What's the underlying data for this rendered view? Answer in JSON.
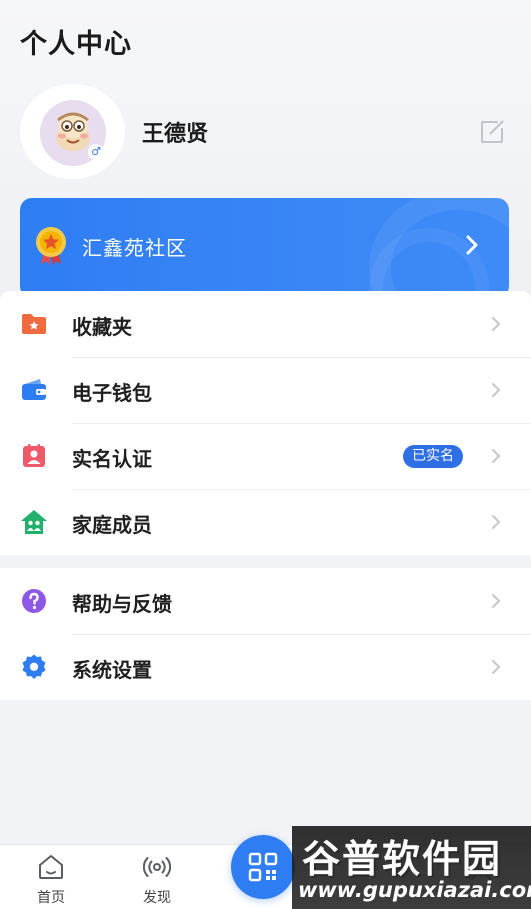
{
  "header": {
    "title": "个人中心"
  },
  "profile": {
    "name": "王德贤",
    "gender_symbol": "♂",
    "avatar_icon": "cartoon-avatar-icon",
    "edit_icon": "edit-icon"
  },
  "community": {
    "label": "汇鑫苑社区",
    "icon": "medal-icon"
  },
  "menu_group_1": [
    {
      "label": "收藏夹",
      "icon": "folder-star-icon",
      "color": "#ef6a3f"
    },
    {
      "label": "电子钱包",
      "icon": "wallet-icon",
      "color": "#2f7df3"
    },
    {
      "label": "实名认证",
      "icon": "id-card-icon",
      "color": "#ef5a6a",
      "badge": "已实名"
    },
    {
      "label": "家庭成员",
      "icon": "home-family-icon",
      "color": "#23b06c"
    }
  ],
  "menu_group_2": [
    {
      "label": "帮助与反馈",
      "icon": "help-icon",
      "color": "#8e58e6"
    },
    {
      "label": "系统设置",
      "icon": "settings-gear-icon",
      "color": "#2f7df3"
    }
  ],
  "tabbar": {
    "home_label": "首页",
    "discover_label": "发现"
  },
  "watermark": {
    "title": "谷普软件园",
    "url": "www.gupuxiazai.com"
  },
  "colors": {
    "accent": "#2f7df3",
    "badge": "#2e6fe6",
    "background": "#f2f3f6"
  }
}
